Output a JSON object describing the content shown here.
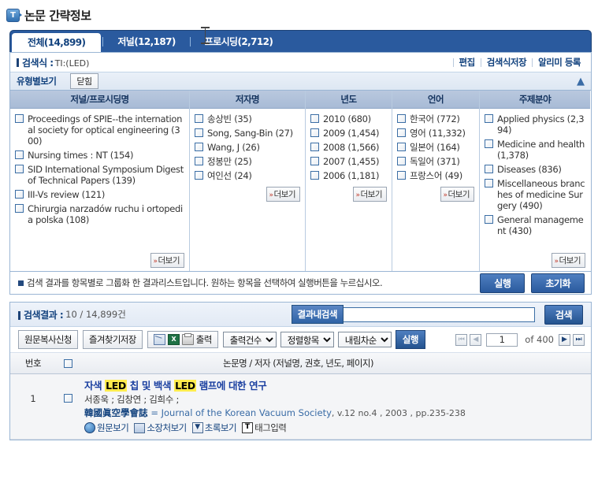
{
  "page": {
    "title": "논문 간략정보",
    "title_icon": "document-info-icon"
  },
  "tabs": [
    {
      "label": "전체(14,899)",
      "active": true
    },
    {
      "label": "저널(12,187)",
      "active": false
    },
    {
      "label": "프로시딩(2,712)",
      "active": false
    }
  ],
  "search_expression": {
    "label": "검색식 :",
    "value": "TI:(LED)",
    "links": [
      "편집",
      "검색식저장",
      "알리미 등록"
    ]
  },
  "type_view": {
    "label": "유형별보기",
    "toggle_button": "닫힘",
    "caret": "▲"
  },
  "facets": [
    {
      "header": "저널/프로시딩명",
      "items": [
        "Proceedings of SPIE--the international society for optical engineering (300)",
        "Nursing times : NT (154)",
        "SID International Symposium Digest of Technical Papers (139)",
        "III-Vs review (121)",
        "Chirurgia narzadów ruchu i ortopedia polska (108)"
      ],
      "more_label": "더보기"
    },
    {
      "header": "저자명",
      "items": [
        "송상빈 (35)",
        "Song, Sang-Bin (27)",
        "Wang, J (26)",
        "정봉만 (25)",
        "여인선 (24)"
      ],
      "more_label": "더보기"
    },
    {
      "header": "년도",
      "items": [
        "2010 (680)",
        "2009 (1,454)",
        "2008 (1,566)",
        "2007 (1,455)",
        "2006 (1,181)"
      ],
      "more_label": "더보기"
    },
    {
      "header": "언어",
      "items": [
        "한국어 (772)",
        "영어 (11,332)",
        "일본어 (164)",
        "독일어 (371)",
        "프랑스어 (49)"
      ],
      "more_label": "더보기"
    },
    {
      "header": "주제분야",
      "items": [
        "Applied physics (2,394)",
        "Medicine and health (1,378)",
        "Diseases (836)",
        "Miscellaneous branches of medicine Surgery (490)",
        "General management (430)"
      ],
      "more_label": "더보기"
    }
  ],
  "notice": {
    "text": "검색 결과를 항목별로 그룹화 한 결과리스트입니다. 원하는 항목을 선택하여 실행버튼을 누르십시오.",
    "run_button": "실행",
    "reset_button": "초기화"
  },
  "results": {
    "label": "검색결과 :",
    "count_text": "10 / 14,899건",
    "in_results_button": "결과내검색",
    "in_results_placeholder": "",
    "in_results_value": "",
    "search_button": "검색"
  },
  "toolbar": {
    "copy_request": "원문복사신청",
    "bookmark_save": "즐겨찾기저장",
    "output_label": "출력",
    "output_icons": [
      "mail-icon",
      "excel-icon",
      "printer-icon"
    ],
    "select_count": "출력건수",
    "select_sort_field": "정렬항목",
    "select_sort_order": "내림차순",
    "run_button": "실행",
    "pager": {
      "first": "◀◀",
      "prev": "◀",
      "page": "1",
      "of_text": "of 400",
      "next": "▶",
      "last": "▶▶"
    }
  },
  "table": {
    "col_no": "번호",
    "col_title": "논문명 / 저자 (저널명, 권호, 년도, 페이지)",
    "rows": [
      {
        "no": "1",
        "title_parts": [
          {
            "text": "자색 ",
            "highlight": false
          },
          {
            "text": "LED",
            "highlight": true
          },
          {
            "text": " 칩 및 백색 ",
            "highlight": false
          },
          {
            "text": "LED",
            "highlight": true
          },
          {
            "text": " 램프에 대한 연구",
            "highlight": false
          }
        ],
        "authors": "서종욱 ; 김창연 ; 김희수 ;",
        "source_kr": "韓國眞空學會誌",
        "source_en": "= Journal of the Korean Vacuum Society",
        "source_meta": ", v.12 no.4 , 2003 , pp.235-238",
        "links": [
          {
            "icon": "globe-icon",
            "label": "원문보기"
          },
          {
            "icon": "library-icon",
            "label": "소장처보기"
          },
          {
            "icon": "download-icon",
            "label": "초록보기"
          },
          {
            "icon": "tag-icon",
            "label": "태그입력"
          }
        ]
      }
    ]
  }
}
